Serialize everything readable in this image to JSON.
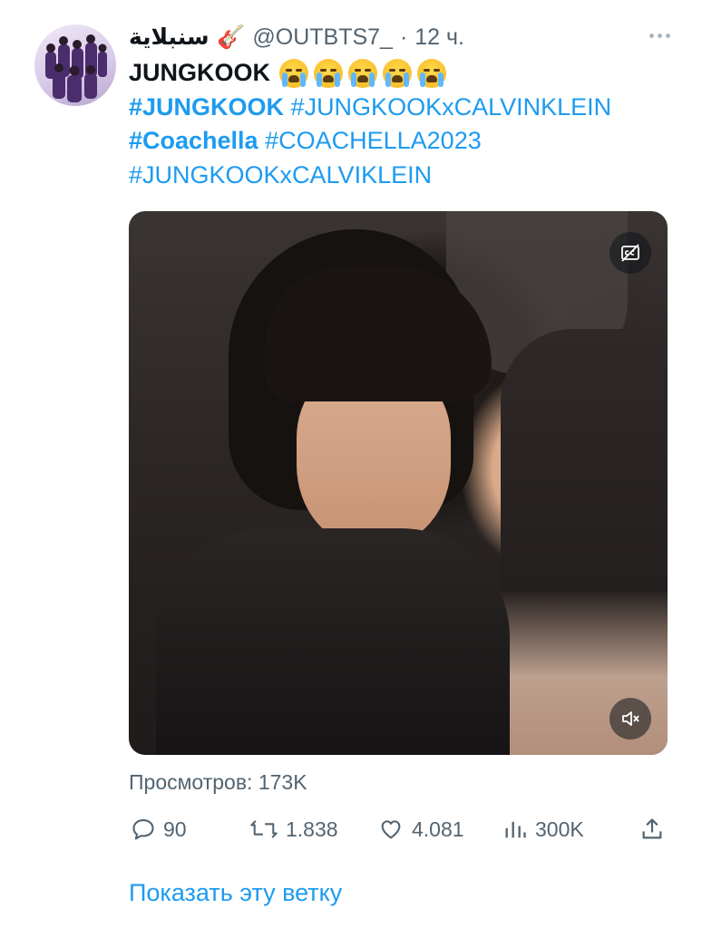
{
  "tweet": {
    "display_name": "سنبلاية 🎸",
    "handle": "@OUTBTS7_",
    "separator": "·",
    "time": "12 ч.",
    "title": "JUNGKOOK",
    "hashtags": {
      "tag1": "#JUNGKOOK",
      "tag2": "#JUNGKOOKxCALVINKLEIN",
      "tag3": "#Coachella",
      "tag4": "#COACHELLA2023",
      "tag5": "#JUNGKOOKxCALVIKLEIN"
    }
  },
  "views": "Просмотров: 173K",
  "actions": {
    "replies": "90",
    "retweets": "1.838",
    "likes": "4.081",
    "analytics": "300K"
  },
  "show_thread": "Показать эту ветку",
  "icons": {
    "more": "more-icon",
    "cc": "closed-captions-icon",
    "mute": "muted-speaker-icon",
    "reply": "reply-icon",
    "retweet": "retweet-icon",
    "like": "heart-icon",
    "analytics": "analytics-icon",
    "share": "share-icon"
  },
  "colors": {
    "link": "#1d9bf0",
    "muted": "#536471",
    "text": "#0f1419"
  }
}
